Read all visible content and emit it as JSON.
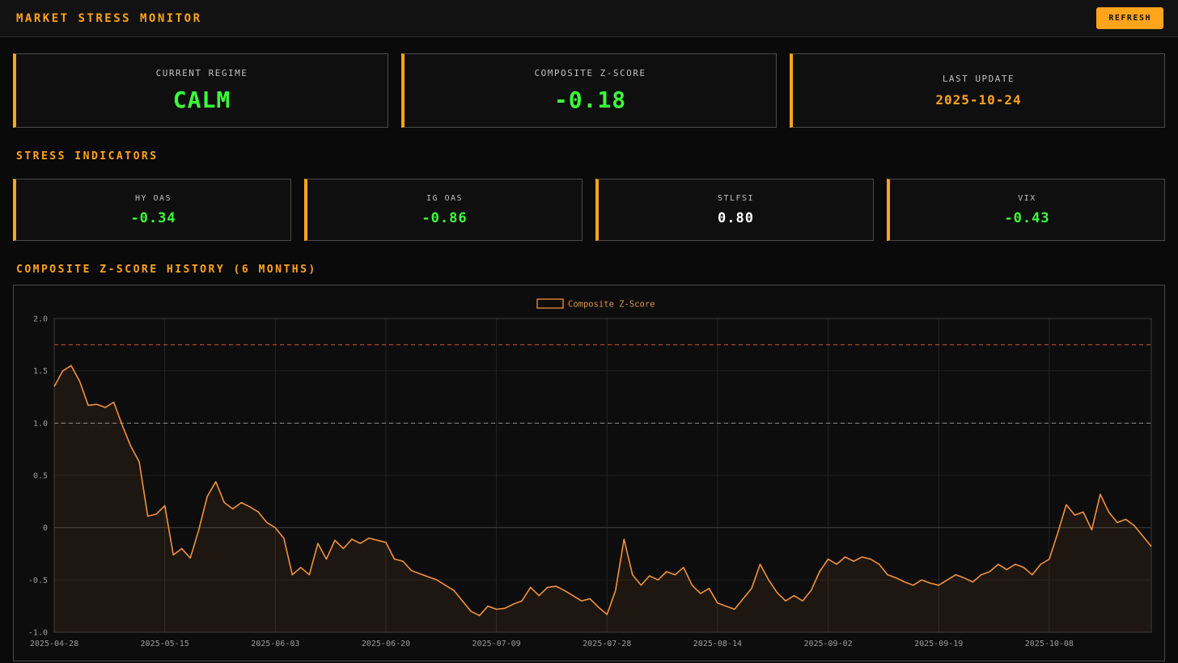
{
  "header": {
    "title": "MARKET STRESS MONITOR",
    "refresh_label": "REFRESH"
  },
  "summary_cards": [
    {
      "label": "CURRENT REGIME",
      "value": "CALM",
      "color": "green"
    },
    {
      "label": "COMPOSITE Z-SCORE",
      "value": "-0.18",
      "color": "green"
    },
    {
      "label": "LAST UPDATE",
      "value": "2025-10-24",
      "color": "orange"
    }
  ],
  "sections": {
    "indicators": "STRESS INDICATORS",
    "history": "COMPOSITE Z-SCORE HISTORY (6 MONTHS)"
  },
  "indicators": [
    {
      "label": "HY OAS",
      "value": "-0.34",
      "color": "green"
    },
    {
      "label": "IG OAS",
      "value": "-0.86",
      "color": "green"
    },
    {
      "label": "STLFSI",
      "value": "0.80",
      "color": "white"
    },
    {
      "label": "VIX",
      "value": "-0.43",
      "color": "green"
    }
  ],
  "colors": {
    "orange": "#ffa41b",
    "green": "#3bff3b",
    "white": "#ffffff",
    "line": "#f0923e",
    "threshold_high": "#d9542b",
    "threshold_mid": "#8f8f8f"
  },
  "chart_data": {
    "type": "line",
    "legend_label": "Composite Z-Score",
    "ylim": [
      -1.0,
      2.0
    ],
    "y_ticks": [
      2.0,
      1.5,
      1.0,
      0.5,
      0,
      -0.5,
      -1.0
    ],
    "y_tick_labels": [
      "2.0",
      "1.5",
      "1.0",
      "0.5",
      "0",
      "-0.5",
      "-1.0"
    ],
    "x_tick_labels": [
      "2025-04-28",
      "2025-05-15",
      "2025-06-03",
      "2025-06-20",
      "2025-07-09",
      "2025-07-28",
      "2025-08-14",
      "2025-09-02",
      "2025-09-19",
      "2025-10-08"
    ],
    "x_tick_indices": [
      0,
      13,
      26,
      39,
      52,
      65,
      78,
      91,
      104,
      117
    ],
    "thresholds": [
      {
        "value": 1.75,
        "color": "#d9542b"
      },
      {
        "value": 1.0,
        "color": "#8f8f8f"
      }
    ],
    "series": [
      {
        "name": "Composite Z-Score",
        "color": "#f0923e",
        "fill": "rgba(240,146,62,0.08)",
        "values": [
          1.35,
          1.5,
          1.55,
          1.4,
          1.17,
          1.18,
          1.15,
          1.2,
          0.98,
          0.78,
          0.63,
          0.11,
          0.13,
          0.21,
          -0.26,
          -0.2,
          -0.29,
          -0.02,
          0.3,
          0.44,
          0.24,
          0.18,
          0.24,
          0.2,
          0.15,
          0.05,
          0.0,
          -0.1,
          -0.45,
          -0.38,
          -0.45,
          -0.15,
          -0.3,
          -0.12,
          -0.2,
          -0.11,
          -0.15,
          -0.1,
          -0.12,
          -0.14,
          -0.3,
          -0.32,
          -0.41,
          -0.44,
          -0.47,
          -0.5,
          -0.55,
          -0.6,
          -0.7,
          -0.8,
          -0.84,
          -0.75,
          -0.78,
          -0.77,
          -0.73,
          -0.7,
          -0.57,
          -0.65,
          -0.57,
          -0.56,
          -0.6,
          -0.65,
          -0.7,
          -0.68,
          -0.76,
          -0.83,
          -0.6,
          -0.11,
          -0.45,
          -0.55,
          -0.46,
          -0.5,
          -0.42,
          -0.45,
          -0.38,
          -0.55,
          -0.63,
          -0.58,
          -0.72,
          -0.75,
          -0.78,
          -0.68,
          -0.58,
          -0.35,
          -0.5,
          -0.62,
          -0.7,
          -0.65,
          -0.7,
          -0.6,
          -0.42,
          -0.3,
          -0.35,
          -0.28,
          -0.32,
          -0.28,
          -0.3,
          -0.35,
          -0.45,
          -0.48,
          -0.52,
          -0.55,
          -0.5,
          -0.53,
          -0.55,
          -0.5,
          -0.45,
          -0.48,
          -0.52,
          -0.45,
          -0.42,
          -0.35,
          -0.4,
          -0.35,
          -0.38,
          -0.45,
          -0.35,
          -0.3,
          -0.05,
          0.22,
          0.12,
          0.15,
          -0.02,
          0.32,
          0.15,
          0.05,
          0.08,
          0.02,
          -0.08,
          -0.18
        ]
      }
    ]
  }
}
